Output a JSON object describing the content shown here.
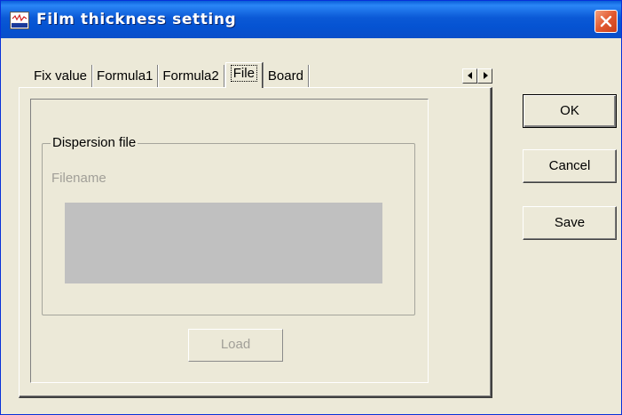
{
  "window": {
    "title": "Film thickness setting"
  },
  "tabs": [
    {
      "label": "Fix value"
    },
    {
      "label": "Formula1"
    },
    {
      "label": "Formula2"
    },
    {
      "label": "File"
    },
    {
      "label": "Board"
    }
  ],
  "active_tab": "File",
  "file_tab": {
    "group_label": "Dispersion file",
    "filename_label": "Filename",
    "filename_value": "",
    "load_label": "Load"
  },
  "buttons": {
    "ok_label": "OK",
    "cancel_label": "Cancel",
    "save_label": "Save"
  },
  "icons": {
    "app": "waveform-app-icon",
    "close": "close-x-icon",
    "scroll_left": "triangle-left-icon",
    "scroll_right": "triangle-right-icon"
  },
  "colors": {
    "titlebar": "#0553d2",
    "close_button": "#e2592f",
    "dialog_face": "#ece9d8",
    "disabled_text": "#a19f98",
    "filename_box": "#c0c0c0"
  }
}
